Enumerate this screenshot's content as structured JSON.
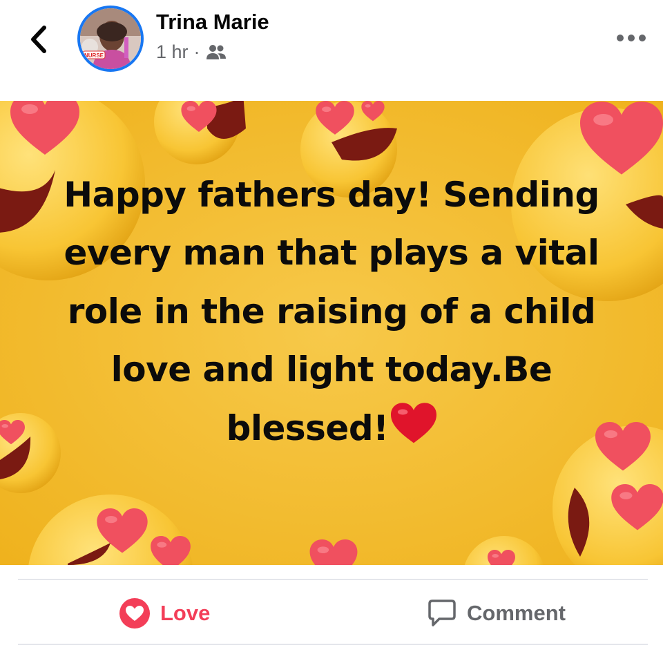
{
  "post": {
    "author": "Trina Marie",
    "time": "1 hr",
    "separator": "·",
    "audience_icon": "friends-icon",
    "avatar_badge": "NURSE",
    "image_text": "Happy fathers day! Sending every man that plays a vital role in the raising of a child love and light today.Be blessed!"
  },
  "actions": {
    "love_label": "Love",
    "comment_label": "Comment"
  },
  "colors": {
    "love_red": "#f33e58",
    "muted_gray": "#65676b",
    "brand_blue": "#1877f2",
    "image_yellow": "#f5bb2c"
  }
}
